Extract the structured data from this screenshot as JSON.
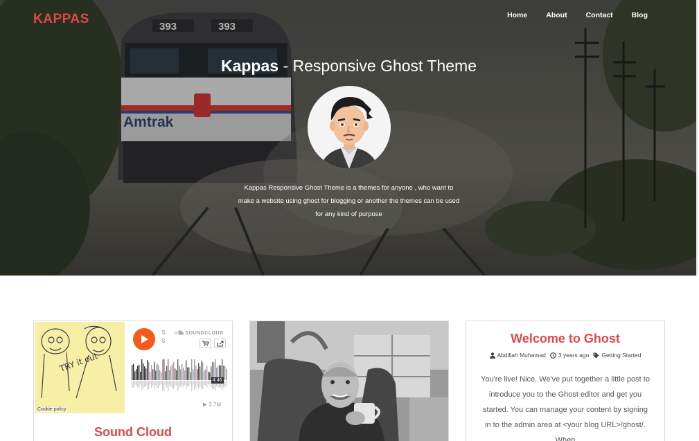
{
  "nav": {
    "brand": "KAPPAS",
    "items": [
      {
        "label": "Home"
      },
      {
        "label": "About"
      },
      {
        "label": "Contact"
      },
      {
        "label": "Blog"
      }
    ]
  },
  "hero": {
    "title_strong": "Kappas",
    "title_rest": " - Responsive Ghost Theme",
    "description": "Kappas Responsive Ghost Theme is a themes for anyone , who want to make a website using ghost for blogging or another the themes can be used for any kind of purpose",
    "background_photo_text": {
      "number_left": "393",
      "number_right": "393",
      "train_label": "Amtrak"
    }
  },
  "posts": [
    {
      "title": "Sound Cloud",
      "embed": {
        "provider": "SOUNDCLOUD",
        "cookie_policy": "Cookie policy",
        "duration": "4:46",
        "plays": "3.7M",
        "artwork_text": "TRY it out",
        "title_initial_1": "S",
        "title_initial_2": "S"
      }
    },
    {
      "title": ""
    },
    {
      "title": "Welcome to Ghost",
      "author": "Abdillah Muhamad",
      "date": "3 years ago",
      "tag": "Getting Started",
      "excerpt": "You're live! Nice. We've put together a little post to introduce you to the Ghost editor and get you started. You can manage your content by signing in to the admin area at <your blog URL>/ghost/. When"
    }
  ],
  "colors": {
    "accent": "#e04848",
    "soundcloud_orange": "#f35a1c",
    "card_border": "#dadada"
  }
}
